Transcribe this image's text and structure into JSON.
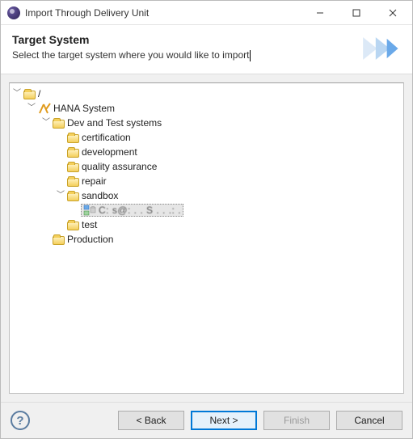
{
  "window": {
    "title": "Import Through Delivery Unit"
  },
  "header": {
    "heading": "Target System",
    "subheading": "Select the target system where you would like to import"
  },
  "tree": {
    "root": "/",
    "hana_system": "HANA System",
    "dev_test": "Dev and Test systems",
    "certification": "certification",
    "development": "development",
    "quality_assurance": "quality assurance",
    "repair": "repair",
    "sandbox": "sandbox",
    "sandbox_item": "C: s@: . . S .  . .: .",
    "test": "test",
    "production": "Production"
  },
  "buttons": {
    "back": "< Back",
    "next": "Next >",
    "finish": "Finish",
    "cancel": "Cancel"
  }
}
